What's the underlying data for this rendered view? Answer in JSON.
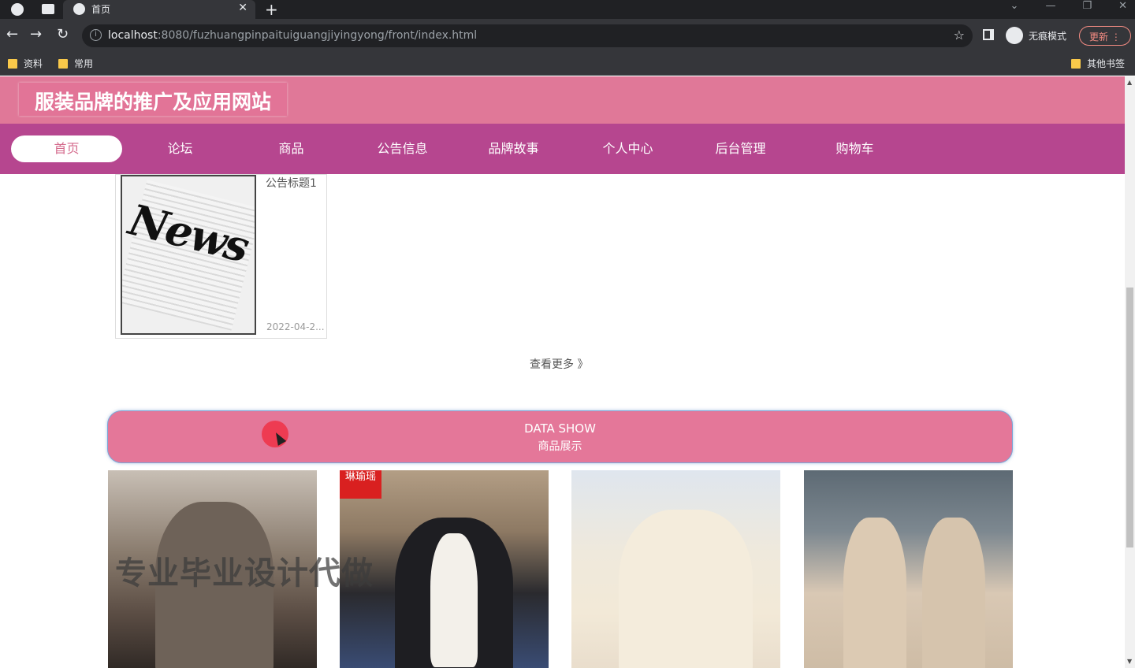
{
  "browser": {
    "tab_title": "首页",
    "url_host": "localhost",
    "url_path": ":8080/fuzhuangpinpaituiguangjiyingyong/front/index.html",
    "incognito_label": "无痕模式",
    "update_label": "更新",
    "bookmarks": [
      "资料",
      "常用"
    ],
    "other_bookmarks": "其他书签"
  },
  "site": {
    "title": "服装品牌的推广及应用网站",
    "nav": [
      "首页",
      "论坛",
      "商品",
      "公告信息",
      "品牌故事",
      "个人中心",
      "后台管理",
      "购物车"
    ],
    "active_nav": "首页"
  },
  "news": {
    "image_text": "News",
    "title": "公告标题1",
    "date": "2022-04-2..."
  },
  "more_label": "查看更多 》",
  "data_show": {
    "en": "DATA SHOW",
    "zh": "商品展示"
  },
  "products": [
    {
      "brand_tag": ""
    },
    {
      "brand_tag": "琳瑜瑶"
    },
    {
      "brand_tag": ""
    },
    {
      "brand_tag": ""
    }
  ],
  "watermark": "专业毕业设计代做",
  "colors": {
    "header": "#e07898",
    "nav": "#b6468f",
    "banner": "#e47799"
  }
}
